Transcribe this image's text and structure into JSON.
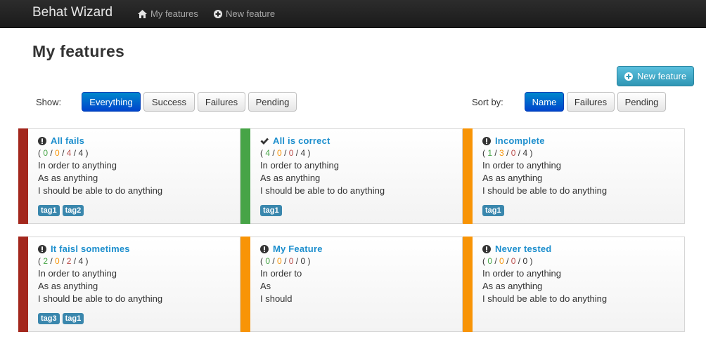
{
  "navbar": {
    "brand": "Behat Wizard",
    "links": [
      {
        "label": "My features",
        "icon": "home-icon"
      },
      {
        "label": "New feature",
        "icon": "plus-circle-icon"
      }
    ]
  },
  "page": {
    "title": "My features",
    "new_feature_button": "New feature"
  },
  "filters": {
    "show_label": "Show:",
    "show_options": [
      "Everything",
      "Success",
      "Failures",
      "Pending"
    ],
    "show_selected": "Everything",
    "sort_label": "Sort by:",
    "sort_options": [
      "Name",
      "Failures",
      "Pending"
    ],
    "sort_selected": "Name"
  },
  "colors": {
    "failed": "#a3271d",
    "passed": "#47a447",
    "pending": "#f89406",
    "link": "#1c8ecd",
    "tag": "#3a87ad"
  },
  "features": [
    {
      "title": "All fails",
      "status": "failed",
      "icon": "exclamation-icon",
      "stats": [
        "0",
        "0",
        "4",
        "4"
      ],
      "lines": [
        "In order to anything",
        "As as anything",
        "I should be able to do anything"
      ],
      "tags": [
        "tag1",
        "tag2"
      ]
    },
    {
      "title": "All is correct",
      "status": "passed",
      "icon": "check-icon",
      "stats": [
        "4",
        "0",
        "0",
        "4"
      ],
      "lines": [
        "In order to anything",
        "As as anything",
        "I should be able to do anything"
      ],
      "tags": [
        "tag1"
      ]
    },
    {
      "title": "Incomplete",
      "status": "pending",
      "icon": "exclamation-icon",
      "stats": [
        "1",
        "3",
        "0",
        "4"
      ],
      "lines": [
        "In order to anything",
        "As as anything",
        "I should be able to do anything"
      ],
      "tags": [
        "tag1"
      ]
    },
    {
      "title": "It faisl sometimes",
      "status": "failed",
      "icon": "exclamation-icon",
      "stats": [
        "2",
        "0",
        "2",
        "4"
      ],
      "lines": [
        "In order to anything",
        "As as anything",
        "I should be able to do anything"
      ],
      "tags": [
        "tag3",
        "tag1"
      ]
    },
    {
      "title": "My Feature",
      "status": "pending",
      "icon": "exclamation-icon",
      "stats": [
        "0",
        "0",
        "0",
        "0"
      ],
      "lines": [
        "In order to",
        "As",
        "I should"
      ],
      "tags": []
    },
    {
      "title": "Never tested",
      "status": "pending",
      "icon": "exclamation-icon",
      "stats": [
        "0",
        "0",
        "0",
        "0"
      ],
      "lines": [
        "In order to anything",
        "As as anything",
        "I should be able to do anything"
      ],
      "tags": []
    }
  ]
}
